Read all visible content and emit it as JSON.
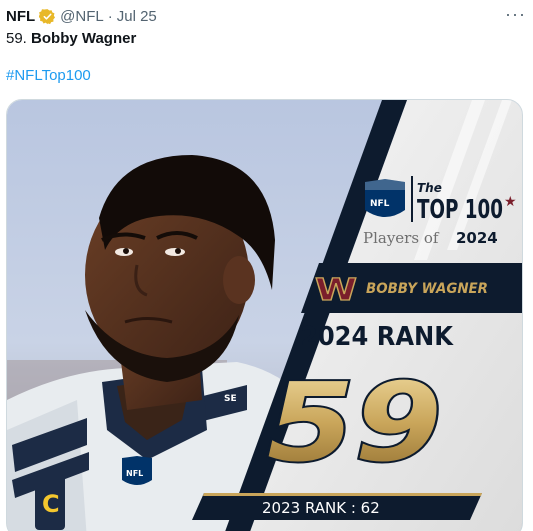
{
  "tweet": {
    "author": "NFL",
    "handle": "@NFL",
    "separator": "·",
    "date": "Jul 25",
    "more_label": "···",
    "text_rank": "59.",
    "text_name": "Bobby Wagner",
    "hashtag": "#NFLTop100"
  },
  "graphic": {
    "logo_the": "The",
    "logo_top100": "TOP 100",
    "logo_players_of": "Players of",
    "logo_year": "2024",
    "team_logo": "W",
    "player_name": "BOBBY WAGNER",
    "rank_label": "2024 RANK",
    "rank_value": "59",
    "prev_rank_label": "2023 RANK : 62",
    "shield_text": "NFL",
    "jersey_patch": "C",
    "sleeve_text": "SE"
  },
  "colors": {
    "link": "#1d9bf0",
    "verified": "#e8b829",
    "navy": "#0d1b2e",
    "gold": "#c9a55a",
    "burgundy": "#7a1e2b"
  }
}
